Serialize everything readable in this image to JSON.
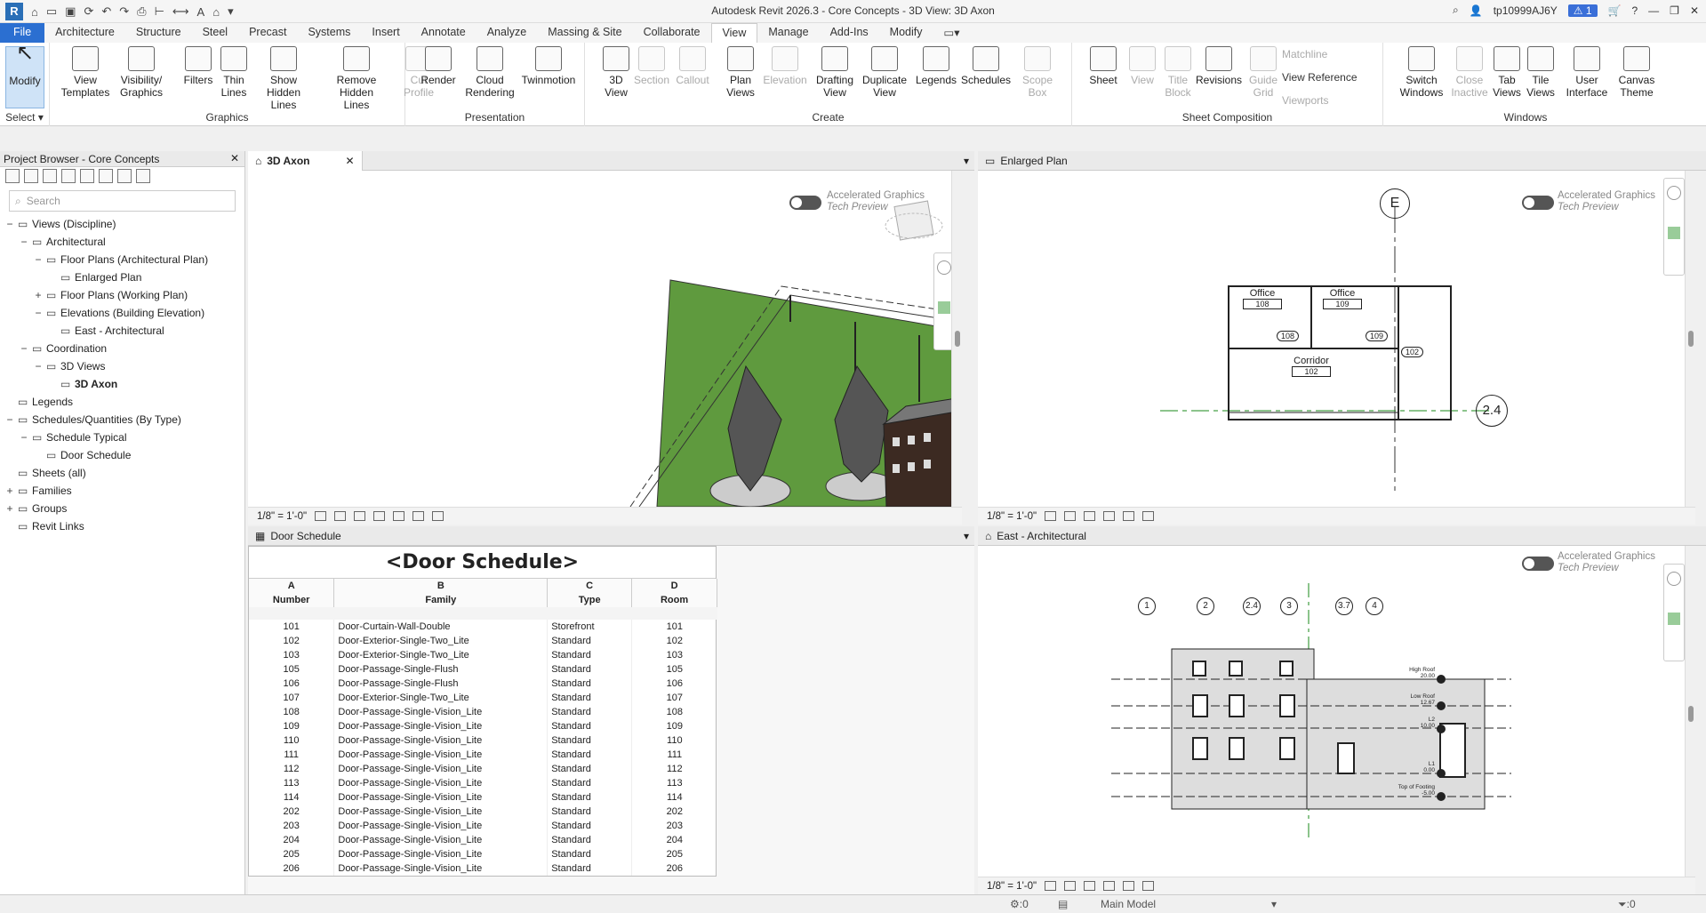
{
  "window": {
    "title": "Autodesk Revit 2026.3 - Core Concepts - 3D View: 3D Axon",
    "user": "tp10999AJ6Y",
    "alerts": "1"
  },
  "tabs": [
    "File",
    "Architecture",
    "Structure",
    "Steel",
    "Precast",
    "Systems",
    "Insert",
    "Annotate",
    "Analyze",
    "Massing & Site",
    "Collaborate",
    "View",
    "Manage",
    "Add-Ins",
    "Modify"
  ],
  "active_tab": "View",
  "ribbon": {
    "select": {
      "modify": "Modify",
      "title": "Select"
    },
    "graphics": {
      "title": "Graphics",
      "buttons": [
        "View\nTemplates",
        "Visibility/\nGraphics",
        "Filters",
        "Thin\nLines",
        "Show\nHidden Lines",
        "Remove\nHidden Lines",
        "Cut\nProfile"
      ]
    },
    "presentation": {
      "title": "Presentation",
      "buttons": [
        "Render",
        "Cloud\nRendering",
        "Twinmotion"
      ]
    },
    "create": {
      "title": "Create",
      "buttons": [
        "3D\nView",
        "Section",
        "Callout",
        "Plan\nViews",
        "Elevation",
        "Drafting\nView",
        "Duplicate\nView",
        "Legends",
        "Schedules",
        "Scope\nBox"
      ]
    },
    "sheet": {
      "title": "Sheet Composition",
      "buttons": [
        "Sheet",
        "View",
        "Title\nBlock",
        "Revisions",
        "Guide\nGrid"
      ],
      "small": [
        "Matchline",
        "View  Reference",
        "Viewports"
      ]
    },
    "windows": {
      "title": "Windows",
      "buttons": [
        "Switch\nWindows",
        "Close\nInactive",
        "Tab\nViews",
        "Tile\nViews",
        "User\nInterface",
        "Canvas\nTheme"
      ]
    }
  },
  "project_browser": {
    "title": "Project Browser - Core Concepts",
    "search_placeholder": "Search",
    "nodes": [
      {
        "label": "Views (Discipline)",
        "toggle": "−",
        "indent": 0
      },
      {
        "label": "Architectural",
        "toggle": "−",
        "indent": 1
      },
      {
        "label": "Floor Plans (Architectural Plan)",
        "toggle": "−",
        "indent": 2
      },
      {
        "label": "Enlarged Plan",
        "toggle": "",
        "indent": 3
      },
      {
        "label": "Floor Plans (Working Plan)",
        "toggle": "+",
        "indent": 2
      },
      {
        "label": "Elevations (Building Elevation)",
        "toggle": "−",
        "indent": 2
      },
      {
        "label": "East - Architectural",
        "toggle": "",
        "indent": 3
      },
      {
        "label": "Coordination",
        "toggle": "−",
        "indent": 1
      },
      {
        "label": "3D Views",
        "toggle": "−",
        "indent": 2
      },
      {
        "label": "3D Axon",
        "toggle": "",
        "indent": 3,
        "bold": true
      },
      {
        "label": "Legends",
        "toggle": "",
        "indent": 0
      },
      {
        "label": "Schedules/Quantities (By Type)",
        "toggle": "−",
        "indent": 0
      },
      {
        "label": "Schedule Typical",
        "toggle": "−",
        "indent": 1
      },
      {
        "label": "Door Schedule",
        "toggle": "",
        "indent": 2
      },
      {
        "label": "Sheets (all)",
        "toggle": "",
        "indent": 0
      },
      {
        "label": "Families",
        "toggle": "+",
        "indent": 0
      },
      {
        "label": "Groups",
        "toggle": "+",
        "indent": 0
      },
      {
        "label": "Revit Links",
        "toggle": "",
        "indent": 0
      }
    ]
  },
  "views": {
    "axon": {
      "tab": "3D Axon",
      "scale": "1/8\" = 1'-0\""
    },
    "plan": {
      "tab": "Enlarged Plan",
      "scale": "1/8\" = 1'-0\"",
      "grid_e": "E",
      "grid_24": "2.4",
      "rooms": [
        {
          "name": "Office",
          "num": "108"
        },
        {
          "name": "Office",
          "num": "109"
        },
        {
          "name": "Corridor",
          "num": "102"
        }
      ],
      "tags": [
        "108",
        "109",
        "102"
      ]
    },
    "schedule": {
      "tab": "Door Schedule"
    },
    "elev": {
      "tab": "East - Architectural",
      "scale": "1/8\" = 1'-0\"",
      "grids": [
        "1",
        "2",
        "2.4",
        "3",
        "3.7",
        "4"
      ],
      "levels": [
        {
          "name": "High Roof",
          "elev": "20.00"
        },
        {
          "name": "Low Roof",
          "elev": "12.67"
        },
        {
          "name": "L2",
          "elev": "10.00"
        },
        {
          "name": "L1",
          "elev": "0.00"
        },
        {
          "name": "Top of Footing",
          "elev": "-5.00"
        }
      ]
    }
  },
  "accel": {
    "line1": "Accelerated Graphics",
    "line2": "Tech Preview"
  },
  "schedule": {
    "title": "<Door Schedule>",
    "letters": [
      "A",
      "B",
      "C",
      "D"
    ],
    "headers": [
      "Number",
      "Family",
      "Type",
      "Room"
    ],
    "rows": [
      [
        "101",
        "Door-Curtain-Wall-Double",
        "Storefront",
        "101"
      ],
      [
        "102",
        "Door-Exterior-Single-Two_Lite",
        "Standard",
        "102"
      ],
      [
        "103",
        "Door-Exterior-Single-Two_Lite",
        "Standard",
        "103"
      ],
      [
        "105",
        "Door-Passage-Single-Flush",
        "Standard",
        "105"
      ],
      [
        "106",
        "Door-Passage-Single-Flush",
        "Standard",
        "106"
      ],
      [
        "107",
        "Door-Exterior-Single-Two_Lite",
        "Standard",
        "107"
      ],
      [
        "108",
        "Door-Passage-Single-Vision_Lite",
        "Standard",
        "108"
      ],
      [
        "109",
        "Door-Passage-Single-Vision_Lite",
        "Standard",
        "109"
      ],
      [
        "110",
        "Door-Passage-Single-Vision_Lite",
        "Standard",
        "110"
      ],
      [
        "111",
        "Door-Passage-Single-Vision_Lite",
        "Standard",
        "111"
      ],
      [
        "112",
        "Door-Passage-Single-Vision_Lite",
        "Standard",
        "112"
      ],
      [
        "113",
        "Door-Passage-Single-Vision_Lite",
        "Standard",
        "113"
      ],
      [
        "114",
        "Door-Passage-Single-Vision_Lite",
        "Standard",
        "114"
      ],
      [
        "202",
        "Door-Passage-Single-Vision_Lite",
        "Standard",
        "202"
      ],
      [
        "203",
        "Door-Passage-Single-Vision_Lite",
        "Standard",
        "203"
      ],
      [
        "204",
        "Door-Passage-Single-Vision_Lite",
        "Standard",
        "204"
      ],
      [
        "205",
        "Door-Passage-Single-Vision_Lite",
        "Standard",
        "205"
      ],
      [
        "206",
        "Door-Passage-Single-Vision_Lite",
        "Standard",
        "206"
      ]
    ]
  },
  "status": {
    "worksets": ":0",
    "model": "Main Model",
    "filter": ":0"
  }
}
